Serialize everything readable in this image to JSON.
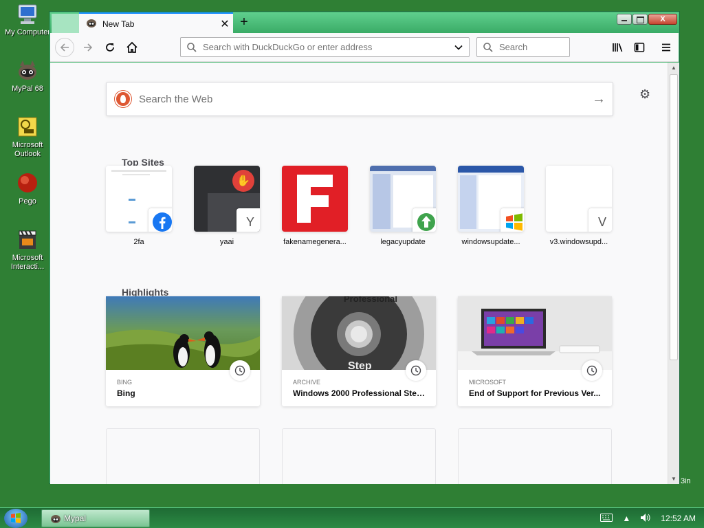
{
  "desktop": {
    "icons": [
      {
        "label": "My Computer",
        "icon": "computer-icon"
      },
      {
        "label": "MyPal 68",
        "icon": "mypal-raccoon-icon"
      },
      {
        "label": "Microsoft Outlook",
        "icon": "outlook-icon"
      },
      {
        "label": "Pego",
        "icon": "pego-icon"
      },
      {
        "label": "Microsoft Interacti...",
        "icon": "clapperboard-icon"
      }
    ],
    "peek_text": "3in"
  },
  "browser": {
    "tab": {
      "title": "New Tab"
    },
    "window_controls": {
      "close": "X"
    },
    "urlbar": {
      "placeholder": "Search with DuckDuckGo or enter address"
    },
    "searchbar": {
      "placeholder": "Search"
    },
    "content": {
      "web_search_placeholder": "Search the Web",
      "top_sites_title": "Top Sites",
      "top_sites": [
        {
          "name": "2fa",
          "badge": "facebook-icon"
        },
        {
          "name": "yaai",
          "badge_letter": "Y"
        },
        {
          "name": "fakenamegenera...",
          "badge": "none"
        },
        {
          "name": "legacyupdate",
          "badge": "update-arrow-icon"
        },
        {
          "name": "windowsupdate...",
          "badge": "windows-logo-icon"
        },
        {
          "name": "v3.windowsupd...",
          "badge_letter": "V"
        }
      ],
      "highlights_title": "Highlights",
      "highlights": [
        {
          "source": "BING",
          "title": "Bing"
        },
        {
          "source": "ARCHIVE",
          "title": "Windows 2000 Professional Step..."
        },
        {
          "source": "MICROSOFT",
          "title": "End of Support for Previous Ver..."
        }
      ],
      "disc_text_1": "Professional",
      "disc_text_2": "Step"
    }
  },
  "taskbar": {
    "task_label": "Mypal",
    "clock": "12:52 AM"
  },
  "colors": {
    "desktop_bg": "#2f7f34",
    "tab_accent": "#0a84ff",
    "frame_green": "#41b36b"
  }
}
